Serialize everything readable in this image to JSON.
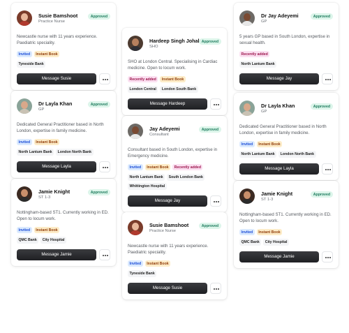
{
  "labels": {
    "approved": "Approved",
    "invited": "Invited",
    "instant_book": "Instant Book",
    "recently_added": "Recently added"
  },
  "cards": [
    {
      "name": "Susie Bamshoot",
      "role": "Practice Nurse",
      "bio": "Newcastle nurse with 11 years experience. Paediatric speciality.",
      "tags": [
        "Invited",
        "Instant Book"
      ],
      "banks": [
        "Tyneside Bank"
      ],
      "button": "Message Susie",
      "avatar": {
        "skin": "#e9b79b",
        "clothes": "#b03a2e",
        "bg": "#7a3b2a",
        "icon": "person-photo-icon"
      }
    },
    {
      "name": "Dr Layla Khan",
      "role": "GP",
      "bio": "Dedicated General Practitioner based in North London, expertise in family medicine.",
      "tags": [
        "Invited",
        "Instant Book"
      ],
      "banks": [
        "North Lantum Bank",
        "London North Bank"
      ],
      "button": "Message Layla",
      "avatar": {
        "skin": "#d9a88a",
        "clothes": "#c9c2b4",
        "bg": "#8aa398",
        "icon": "person-photo-icon"
      }
    },
    {
      "name": "Jamie Knight",
      "role": "ST 1-3",
      "bio": "Nottingham-based ST1. Currently working in ED. Open to locum work.",
      "tags": [
        "Invited",
        "Instant Book"
      ],
      "banks": [
        "QMC Bank",
        "City Hospital"
      ],
      "button": "Message Jamie",
      "avatar": {
        "skin": "#c98f6b",
        "clothes": "#2b2b2b",
        "bg": "#3c2a22",
        "icon": "person-photo-icon"
      }
    },
    {
      "name": "Hardeep Singh Johal",
      "role": "SHO",
      "bio": "SHO at London Central. Specialising in Cardiac medicine. Open to locum work.",
      "tags": [
        "Recently added",
        "Instant Book"
      ],
      "banks": [
        "London Central",
        "London South Bank"
      ],
      "button": "Message Hardeep",
      "avatar": {
        "skin": "#b7805e",
        "clothes": "#2f2f35",
        "bg": "#4d3b30",
        "icon": "person-photo-icon"
      }
    },
    {
      "name": "Jay Adeyemi",
      "role": "Consultant",
      "bio": "Consultant based in South London, expertise in Emergency medicine.",
      "tags": [
        "Invited",
        "Instant Book",
        "Recently added"
      ],
      "banks": [
        "North Lantum Bank",
        "South London Bank",
        "Whittington Hospital"
      ],
      "button": "Message Jay",
      "avatar": {
        "skin": "#7a4a32",
        "clothes": "#e8e8e8",
        "bg": "#6d6a66",
        "icon": "person-photo-icon"
      }
    },
    {
      "name": "Susie Bamshoot",
      "role": "Practice Nurse",
      "bio": "Newcastle nurse with 11 years experience. Paediatric speciality.",
      "tags": [
        "Invited",
        "Instant Book"
      ],
      "banks": [
        "Tyneside Bank"
      ],
      "button": "Message Susie",
      "avatar": {
        "skin": "#e9b79b",
        "clothes": "#b03a2e",
        "bg": "#7a3b2a",
        "icon": "person-photo-icon"
      }
    },
    {
      "name": "Dr Jay Adeyemi",
      "role": "GP",
      "bio": "5 years GP based in South London, expertise in sexual health.",
      "tags": [
        "Recently added"
      ],
      "banks": [
        "North Lantum Bank"
      ],
      "button": "Message Jay",
      "avatar": {
        "skin": "#7a4a32",
        "clothes": "#e8e8e8",
        "bg": "#6d6a66",
        "icon": "person-photo-icon"
      }
    },
    {
      "name": "Dr Layla Khan",
      "role": "GP",
      "bio": "Dedicated General Practitioner based in North London, expertise in family medicine.",
      "tags": [
        "Invited",
        "Instant Book"
      ],
      "banks": [
        "North Lantum Bank",
        "London North Bank"
      ],
      "button": "Message Layla",
      "avatar": {
        "skin": "#d9a88a",
        "clothes": "#c9c2b4",
        "bg": "#8aa398",
        "icon": "person-photo-icon"
      }
    },
    {
      "name": "Jamie Knight",
      "role": "ST 1-3",
      "bio": "Nottingham-based ST1. Currently working in ED. Open to locum work.",
      "tags": [
        "Invited",
        "Instant Book"
      ],
      "banks": [
        "QMC Bank",
        "City Hospital"
      ],
      "button": "Message Jamie",
      "avatar": {
        "skin": "#c98f6b",
        "clothes": "#2b2b2b",
        "bg": "#3c2a22",
        "icon": "person-photo-icon"
      }
    }
  ]
}
